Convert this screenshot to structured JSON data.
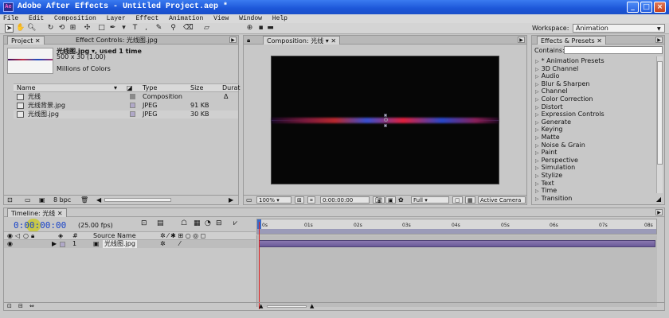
{
  "window": {
    "title": "Adobe After Effects - Untitled Project.aep *",
    "app_icon": "Ae"
  },
  "menu": [
    "File",
    "Edit",
    "Composition",
    "Layer",
    "Effect",
    "Animation",
    "View",
    "Window",
    "Help"
  ],
  "toolbar": {
    "workspace_label": "Workspace:",
    "workspace_value": "Animation"
  },
  "project": {
    "tab_project": "Project",
    "tab_effect_controls": "Effect Controls: 光线图.jpg",
    "selected_name": "光线图.jpg ▾, used 1 time",
    "selected_dims": "500 x 30 (1.00)",
    "selected_colors": "Millions of Colors",
    "columns": {
      "name": "Name",
      "type": "Type",
      "size": "Size",
      "duration": "Durat"
    },
    "rows": [
      {
        "name": "光线",
        "type": "Composition",
        "size": "",
        "dur": "Δ"
      },
      {
        "name": "光线背景.jpg",
        "type": "JPEG",
        "size": "91 KB",
        "dur": ""
      },
      {
        "name": "光线图.jpg",
        "type": "JPEG",
        "size": "30 KB",
        "dur": ""
      }
    ],
    "bpc": "8 bpc"
  },
  "composition": {
    "tab": "Composition: 光线",
    "zoom": "100%",
    "timecode": "0:00:00:00",
    "resolution": "Full",
    "camera": "Active Camera"
  },
  "effects": {
    "tab": "Effects & Presets",
    "contains_label": "Contains:",
    "items": [
      "* Animation Presets",
      "3D Channel",
      "Audio",
      "Blur & Sharpen",
      "Channel",
      "Color Correction",
      "Distort",
      "Expression Controls",
      "Generate",
      "Keying",
      "Matte",
      "Noise & Grain",
      "Paint",
      "Perspective",
      "Simulation",
      "Stylize",
      "Text",
      "Time",
      "Transition"
    ]
  },
  "timeline": {
    "tab": "Timeline: 光线",
    "timecode": "0:00:00:00",
    "fps": "(25.00 fps)",
    "source_name_header": "Source Name",
    "layer_number": "1",
    "layer_name": "光线图.jpg",
    "ticks": [
      "0s",
      "01s",
      "02s",
      "03s",
      "04s",
      "05s",
      "06s",
      "07s",
      "08s"
    ]
  },
  "colors": {
    "titlebar": "#1c56d8",
    "timecode": "#1a44c8",
    "playhead": "#e02020",
    "layer_bar": "#6a5a98"
  }
}
